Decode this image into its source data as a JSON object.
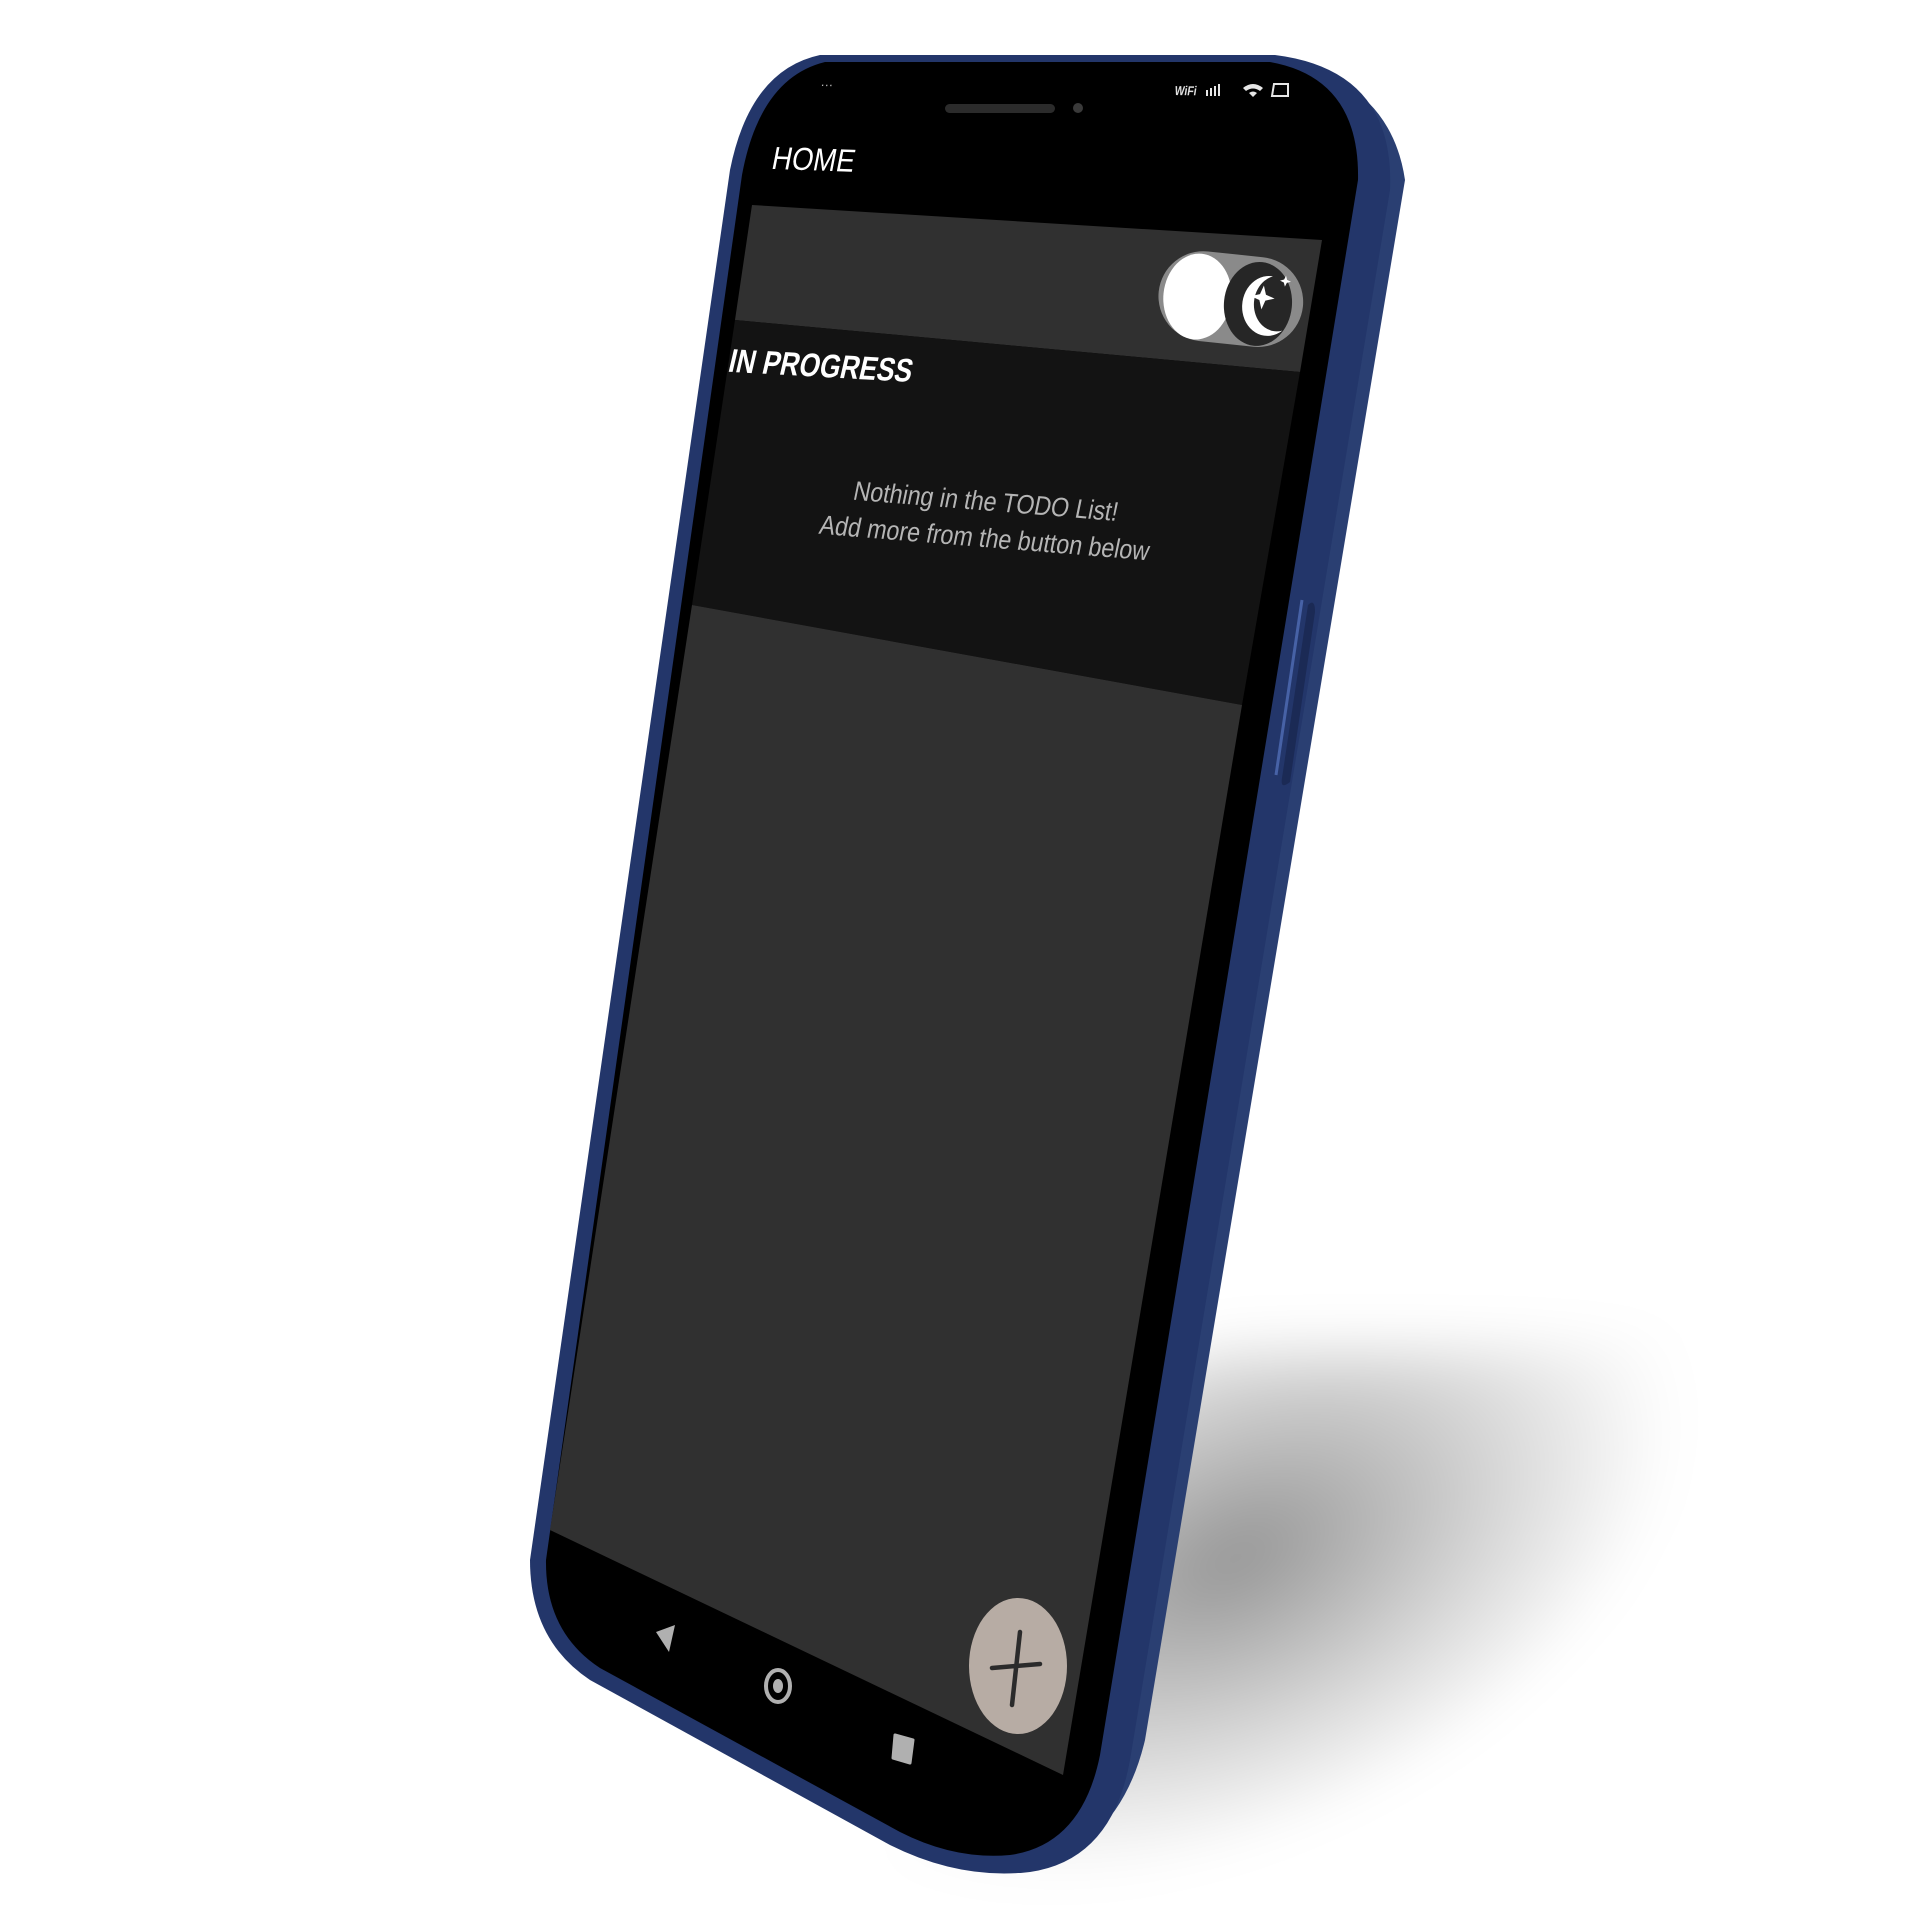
{
  "app": {
    "title": "HOME",
    "section_header": "IN PROGRESS",
    "empty_message_line1": "Nothing in the TODO List!",
    "empty_message_line2": "Add more from the button below"
  },
  "status_bar": {
    "time": "…",
    "indicators": "WiFi",
    "icons": [
      "wifi-signal-icon",
      "cellular-signal-icon",
      "battery-icon"
    ]
  },
  "theme_toggle": {
    "icon": "moon-stars-icon",
    "state": "dark"
  },
  "fab": {
    "icon": "plus-icon"
  },
  "nav_bar": {
    "icons": [
      "back-triangle-icon",
      "home-circle-icon",
      "recents-square-icon"
    ]
  },
  "colors": {
    "frame": "#2e4478",
    "screen_bg": "#000000",
    "card_bg": "#303030",
    "list_bg": "#131313",
    "toggle_track": "#8a8a8a",
    "fab_bg": "#b7aca4"
  }
}
